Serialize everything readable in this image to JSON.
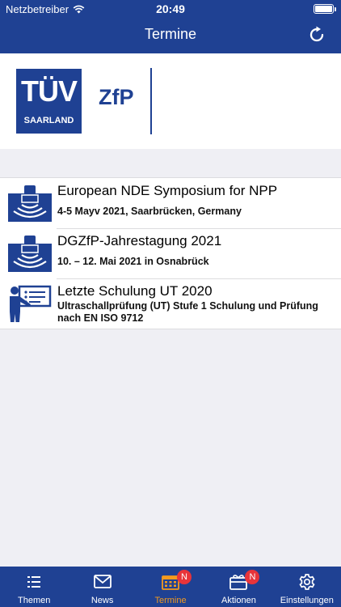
{
  "status_bar": {
    "carrier": "Netzbetreiber",
    "time": "20:49"
  },
  "nav": {
    "title": "Termine"
  },
  "logo": {
    "brand_line1": "TÜV",
    "brand_line2": "SAARLAND",
    "division": "ZfP"
  },
  "events": [
    {
      "title": "European NDE Symposium for NPP",
      "subtitle": "4-5 Mayv 2021, Saarbrücken, Germany",
      "icon": "ultrasonic-probe-icon"
    },
    {
      "title": "DGZfP-Jahrestagung 2021",
      "subtitle": "10. – 12. Mai 2021 in Osnabrück",
      "icon": "ultrasonic-probe-icon"
    },
    {
      "title": "Letzte Schulung UT 2020",
      "subtitle": "Ultraschallprüfung (UT) Stufe 1 Schulung und Prüfung nach EN ISO 9712",
      "icon": "presentation-icon"
    }
  ],
  "tabs": [
    {
      "label": "Themen",
      "icon": "list-icon",
      "active": false
    },
    {
      "label": "News",
      "icon": "mail-icon",
      "active": false
    },
    {
      "label": "Termine",
      "icon": "calendar-icon",
      "active": true,
      "badge": "N"
    },
    {
      "label": "Aktionen",
      "icon": "gift-card-icon",
      "active": false,
      "badge": "N"
    },
    {
      "label": "Einstellungen",
      "icon": "gear-icon",
      "active": false
    }
  ],
  "colors": {
    "brand": "#1f4193",
    "active_tab": "#f39a1e",
    "badge": "#e8343a",
    "background": "#efeff4"
  }
}
